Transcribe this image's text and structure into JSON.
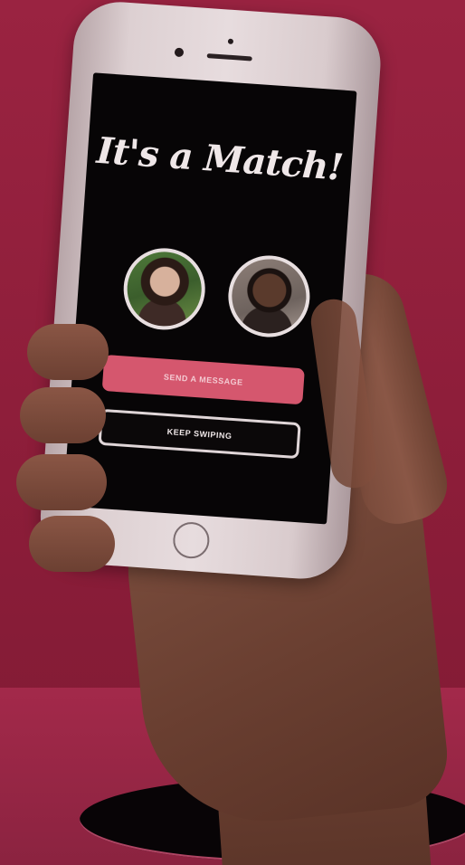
{
  "screen": {
    "title": "It's a Match!",
    "avatars": [
      {
        "name": "left-match-photo"
      },
      {
        "name": "right-match-photo"
      }
    ],
    "buttons": {
      "send_message": "Send a message",
      "keep_swiping": "Keep swiping"
    }
  },
  "colors": {
    "background": "#8f1f3c",
    "screen": "#070506",
    "send_button": "#d5576e",
    "keep_button_border": "#e0d6d8"
  },
  "icons": {
    "home_button": "home-button-icon"
  }
}
